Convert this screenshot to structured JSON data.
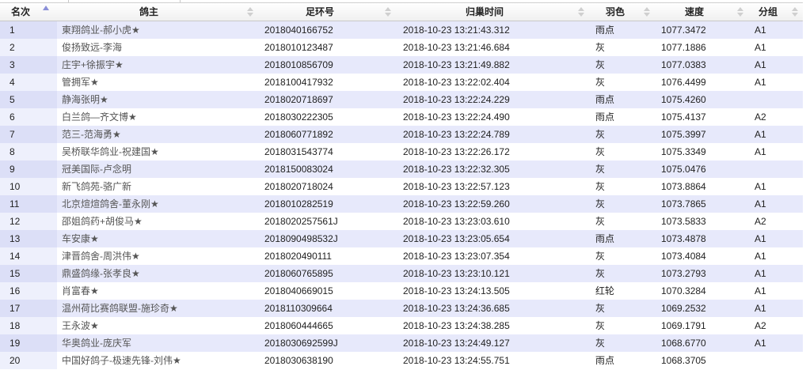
{
  "header": {
    "rank": "名次",
    "owner": "鸽主",
    "ring": "足环号",
    "time": "归巢时间",
    "color": "羽色",
    "speed": "速度",
    "group": "分组"
  },
  "rows": [
    {
      "rank": "1",
      "owner": "東翔鸽业-郝小虎★",
      "ring": "2018040166752",
      "time": "2018-10-23 13:21:43.312",
      "color": "雨点",
      "speed": "1077.3472",
      "group": "A1"
    },
    {
      "rank": "2",
      "owner": "俊扬致远-李海",
      "ring": "2018010123487",
      "time": "2018-10-23 13:21:46.684",
      "color": "灰",
      "speed": "1077.1886",
      "group": "A1"
    },
    {
      "rank": "3",
      "owner": "庄宇+徐振宇★",
      "ring": "2018010856709",
      "time": "2018-10-23 13:21:49.882",
      "color": "灰",
      "speed": "1077.0383",
      "group": "A1"
    },
    {
      "rank": "4",
      "owner": "管拥军★",
      "ring": "2018100417932",
      "time": "2018-10-23 13:22:02.404",
      "color": "灰",
      "speed": "1076.4499",
      "group": "A1"
    },
    {
      "rank": "5",
      "owner": "静海张明★",
      "ring": "2018020718697",
      "time": "2018-10-23 13:22:24.229",
      "color": "雨点",
      "speed": "1075.4260",
      "group": ""
    },
    {
      "rank": "6",
      "owner": "白兰鸽—齐文博★",
      "ring": "2018030222305",
      "time": "2018-10-23 13:22:24.490",
      "color": "雨点",
      "speed": "1075.4137",
      "group": "A2"
    },
    {
      "rank": "7",
      "owner": "范三-范海勇★",
      "ring": "2018060771892",
      "time": "2018-10-23 13:22:24.789",
      "color": "灰",
      "speed": "1075.3997",
      "group": "A1"
    },
    {
      "rank": "8",
      "owner": "吴桥联华鸽业-祝建国★",
      "ring": "2018031543774",
      "time": "2018-10-23 13:22:26.172",
      "color": "灰",
      "speed": "1075.3349",
      "group": "A1"
    },
    {
      "rank": "9",
      "owner": "冠美国际-卢念明",
      "ring": "2018150083024",
      "time": "2018-10-23 13:22:32.305",
      "color": "灰",
      "speed": "1075.0476",
      "group": ""
    },
    {
      "rank": "10",
      "owner": "新飞鸽苑-骆广新",
      "ring": "2018020718024",
      "time": "2018-10-23 13:22:57.123",
      "color": "灰",
      "speed": "1073.8864",
      "group": "A1"
    },
    {
      "rank": "11",
      "owner": "北京煊煊鸽舍-董永刚★",
      "ring": "2018010282519",
      "time": "2018-10-23 13:22:59.260",
      "color": "灰",
      "speed": "1073.7865",
      "group": "A1"
    },
    {
      "rank": "12",
      "owner": "邵姐鸽药+胡俊马★",
      "ring": "2018020257561J",
      "time": "2018-10-23 13:23:03.610",
      "color": "灰",
      "speed": "1073.5833",
      "group": "A2"
    },
    {
      "rank": "13",
      "owner": "车安康★",
      "ring": "2018090498532J",
      "time": "2018-10-23 13:23:05.654",
      "color": "雨点",
      "speed": "1073.4878",
      "group": "A1"
    },
    {
      "rank": "14",
      "owner": "津晋鸽舍-周洪伟★",
      "ring": "2018020490111",
      "time": "2018-10-23 13:23:07.354",
      "color": "灰",
      "speed": "1073.4084",
      "group": "A1"
    },
    {
      "rank": "15",
      "owner": "鼎盛鸽缘-张孝良★",
      "ring": "2018060765895",
      "time": "2018-10-23 13:23:10.121",
      "color": "灰",
      "speed": "1073.2793",
      "group": "A1"
    },
    {
      "rank": "16",
      "owner": "肖富春★",
      "ring": "2018040669015",
      "time": "2018-10-23 13:24:13.505",
      "color": "红轮",
      "speed": "1070.3284",
      "group": "A1"
    },
    {
      "rank": "17",
      "owner": "温州荷比赛鸽联盟-施珍奇★",
      "ring": "2018110309664",
      "time": "2018-10-23 13:24:36.685",
      "color": "灰",
      "speed": "1069.2532",
      "group": "A1"
    },
    {
      "rank": "18",
      "owner": "王永波★",
      "ring": "2018060444665",
      "time": "2018-10-23 13:24:38.285",
      "color": "灰",
      "speed": "1069.1791",
      "group": "A2"
    },
    {
      "rank": "19",
      "owner": "华奥鸽业-庞庆军",
      "ring": "2018030692599J",
      "time": "2018-10-23 13:24:49.127",
      "color": "灰",
      "speed": "1068.6770",
      "group": "A1"
    },
    {
      "rank": "20",
      "owner": "中国好鸽子-极速先锋-刘伟★",
      "ring": "2018030638190",
      "time": "2018-10-23 13:24:55.751",
      "color": "雨点",
      "speed": "1068.3705",
      "group": ""
    }
  ]
}
